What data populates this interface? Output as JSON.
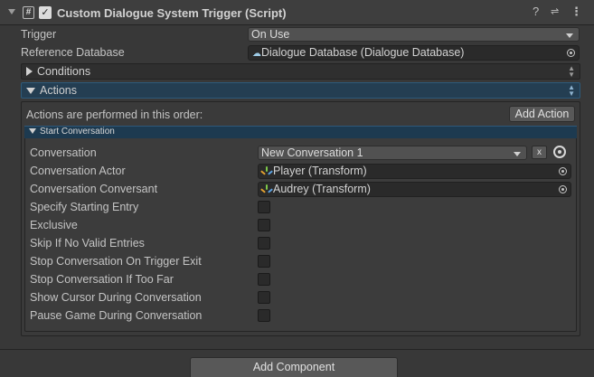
{
  "component": {
    "title": "Custom Dialogue System Trigger (Script)",
    "enabled": true,
    "header_icons": [
      "help-icon",
      "preset-icon",
      "more-icon"
    ]
  },
  "fields": {
    "trigger": {
      "label": "Trigger",
      "value": "On Use"
    },
    "reference_database": {
      "label": "Reference Database",
      "value": "Dialogue Database (Dialogue Database)"
    }
  },
  "conditions": {
    "label": "Conditions"
  },
  "actions": {
    "label": "Actions",
    "order_text": "Actions are performed in this order:",
    "add_action_label": "Add Action"
  },
  "start_conversation": {
    "label": "Start Conversation",
    "conversation": {
      "label": "Conversation",
      "value": "New Conversation 1",
      "clear_label": "x"
    },
    "actor": {
      "label": "Conversation Actor",
      "value": "Player (Transform)"
    },
    "conversant": {
      "label": "Conversation Conversant",
      "value": "Audrey (Transform)"
    },
    "toggles": [
      {
        "label": "Specify Starting Entry",
        "checked": false
      },
      {
        "label": "Exclusive",
        "checked": false
      },
      {
        "label": "Skip If No Valid Entries",
        "checked": false
      },
      {
        "label": "Stop Conversation On Trigger Exit",
        "checked": false
      },
      {
        "label": "Stop Conversation If Too Far",
        "checked": false
      },
      {
        "label": "Show Cursor During Conversation",
        "checked": false
      },
      {
        "label": "Pause Game During Conversation",
        "checked": false
      }
    ]
  },
  "add_component_label": "Add Component",
  "colors": {
    "background": "#383838",
    "selected_bar": "#243e52",
    "sub_header": "#1d3a50",
    "field": "#2a2a2a"
  }
}
